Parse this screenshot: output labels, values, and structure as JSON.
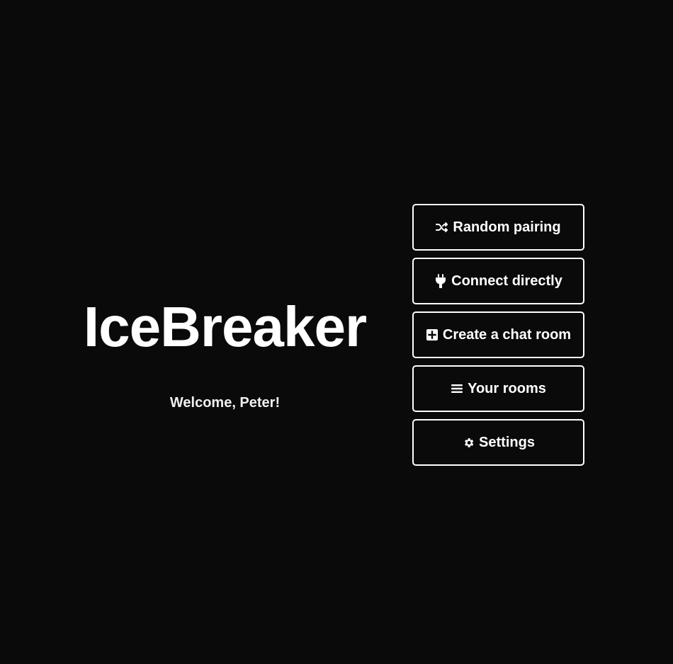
{
  "app": {
    "title": "IceBreaker",
    "welcome": "Welcome, Peter!"
  },
  "menu": {
    "items": [
      {
        "label": "Random pairing",
        "icon": "shuffle-icon"
      },
      {
        "label": "Connect directly",
        "icon": "plug-icon"
      },
      {
        "label": "Create a chat room",
        "icon": "plus-square-icon"
      },
      {
        "label": "Your rooms",
        "icon": "list-icon"
      },
      {
        "label": "Settings",
        "icon": "gear-icon"
      }
    ]
  },
  "colors": {
    "background": "#0a0a0a",
    "text": "#ffffff",
    "button_border": "#ffffff"
  }
}
